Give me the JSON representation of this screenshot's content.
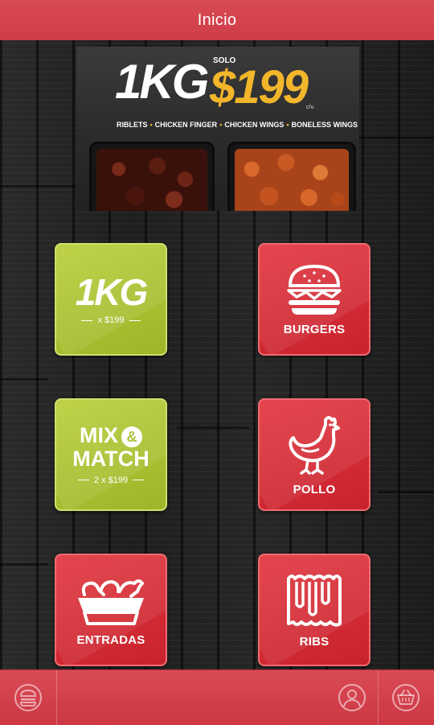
{
  "header": {
    "title": "Inicio"
  },
  "banner": {
    "weight": "1KG",
    "solo": "SOLO",
    "price": "$199",
    "per_unit": "c/u",
    "items": [
      "RIBLETS",
      "CHICKEN FINGER",
      "CHICKEN WINGS",
      "BONELESS WINGS"
    ]
  },
  "tiles": {
    "kg": {
      "big": "1KG",
      "sub": "x $199"
    },
    "burgers": {
      "label": "BURGERS"
    },
    "mix": {
      "line1": "MIX",
      "amp": "&",
      "line2": "MATCH",
      "sub": "2 x $199"
    },
    "pollo": {
      "label": "POLLO"
    },
    "entradas": {
      "label": "ENTRADAS"
    },
    "ribs": {
      "label": "RIBS"
    }
  },
  "bottom_nav": {
    "icons": [
      "menu-burger-icon",
      "user-profile-icon",
      "basket-icon"
    ]
  },
  "colors": {
    "brand_red": "#d3404b",
    "tile_red": "#d62c36",
    "tile_green": "#adc232",
    "price_gold": "#f2b62b"
  }
}
